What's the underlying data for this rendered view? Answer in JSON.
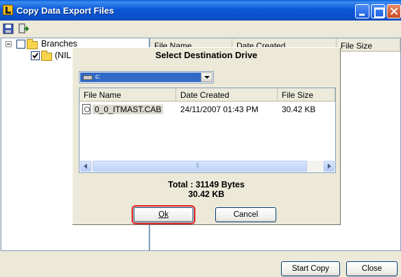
{
  "window": {
    "title": "Copy Data Export Files",
    "minimize_label": "",
    "maximize_label": "",
    "close_label": ""
  },
  "toolbar": {
    "icons": [
      "save-icon",
      "export-icon"
    ]
  },
  "tree": {
    "root_label": "Branches",
    "child_label": "(NIL"
  },
  "list_columns": [
    "File Name",
    "Date Created",
    "File Size"
  ],
  "dialog": {
    "title": "Select Destination Drive",
    "drive_value": "c:",
    "columns": [
      "File Name",
      "Date Created",
      "File Size"
    ],
    "files": [
      {
        "name": "0_0_ITMAST.CAB",
        "date": "24/11/2007 01:43 PM",
        "size": "30.42 KB"
      }
    ],
    "total_bytes": "Total : 31149 Bytes",
    "total_kb": "30.42 KB",
    "ok_label": "Ok",
    "cancel_label": "Cancel"
  },
  "footer": {
    "start_copy_label": "Start Copy",
    "close_label": "Close"
  }
}
